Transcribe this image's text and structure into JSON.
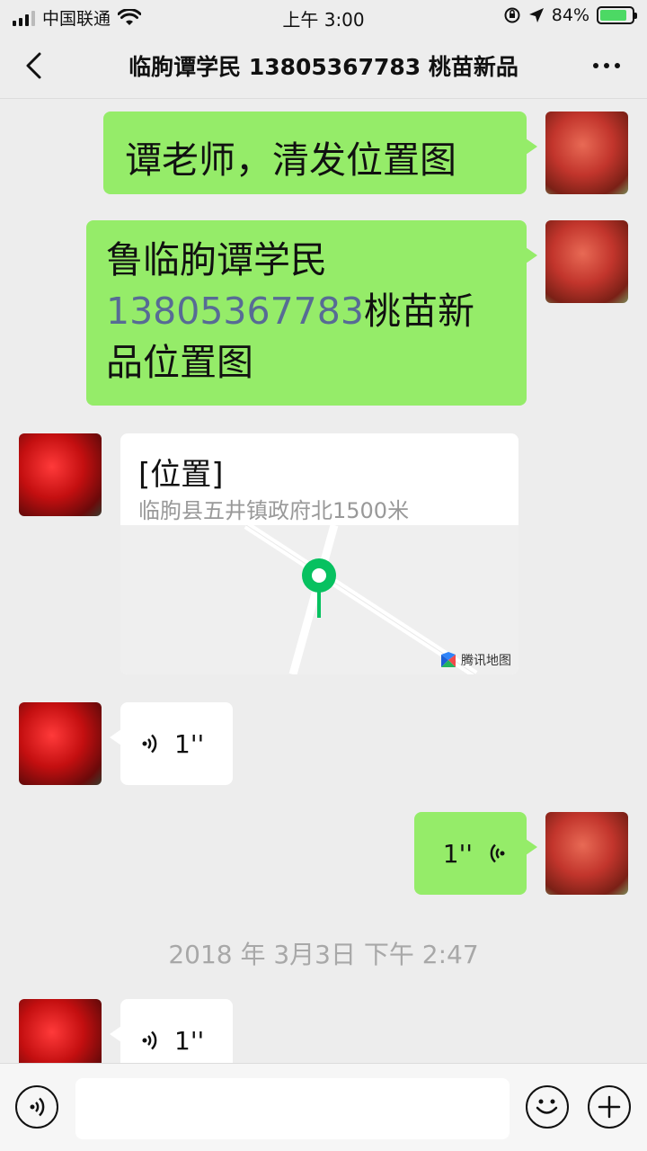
{
  "status_bar": {
    "carrier": "中国联通",
    "time": "上午 3:00",
    "battery_percent": "84%",
    "battery_level": 0.84,
    "icons": [
      "signal-icon",
      "wifi-icon",
      "orientation-lock-icon",
      "location-icon",
      "battery-charging-icon"
    ]
  },
  "nav": {
    "title": "临朐谭学民 13805367783 桃苗新品",
    "back_icon": "chevron-left-icon",
    "more_icon": "more-dots-icon"
  },
  "messages": [
    {
      "id": "m1",
      "side": "right",
      "type": "text",
      "text": "谭老师，清发位置图"
    },
    {
      "id": "m2",
      "side": "right",
      "type": "text",
      "parts": {
        "prefix": "鲁临朐谭学民",
        "phone": "13805367783",
        "suffix": "桃苗新品位置图"
      }
    },
    {
      "id": "m3",
      "side": "left",
      "type": "location",
      "title": "[位置]",
      "address": "临朐县五井镇政府北1500米",
      "map_brand": "腾讯地图"
    },
    {
      "id": "m4",
      "side": "left",
      "type": "voice",
      "duration": "1''"
    },
    {
      "id": "m5",
      "side": "right",
      "type": "voice",
      "duration": "1''"
    },
    {
      "id": "m6",
      "side": "left",
      "type": "voice",
      "duration": "1''"
    }
  ],
  "timestamp": "2018 年 3月3日 下午 2:47",
  "input_bar": {
    "placeholder": "",
    "voice_icon": "voice-input-icon",
    "emoji_icon": "emoji-icon",
    "plus_icon": "plus-icon"
  },
  "colors": {
    "background": "#ededed",
    "bubble_self": "#95ec69",
    "bubble_other": "#ffffff",
    "link": "#576b95",
    "pin": "#07c160"
  }
}
